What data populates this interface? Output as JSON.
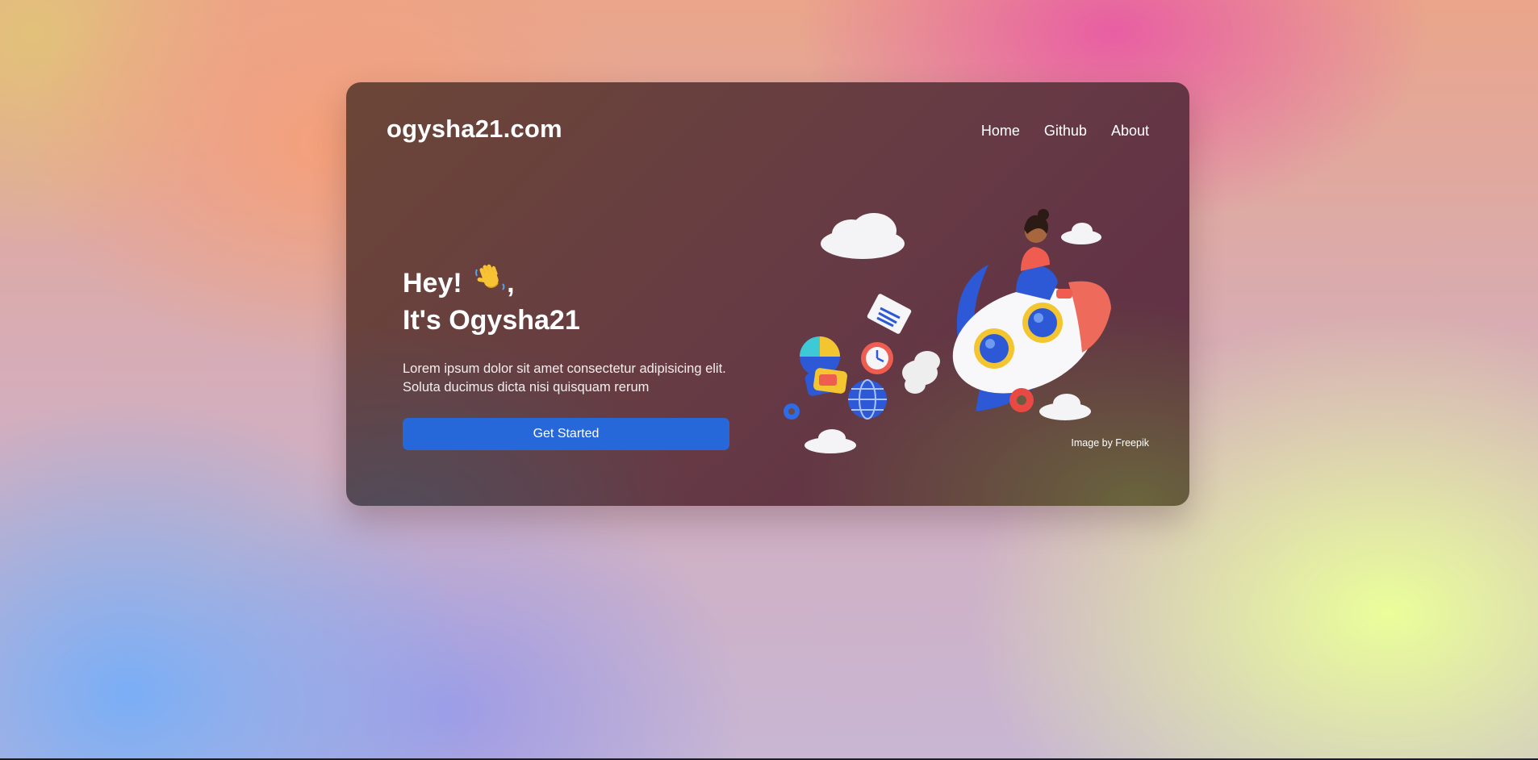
{
  "site": {
    "brand": "ogysha21.com"
  },
  "nav": {
    "items": [
      {
        "label": "Home"
      },
      {
        "label": "Github"
      },
      {
        "label": "About"
      }
    ]
  },
  "hero": {
    "greeting_line1": "Hey!",
    "greeting_line1_suffix": ",",
    "greeting_icon": "waving-hand-icon",
    "greeting_line2": "It's Ogysha21",
    "description_line1": "Lorem ipsum dolor sit amet consectetur adipisicing elit.",
    "description_line2": "Soluta ducimus dicta nisi quisquam rerum",
    "cta_label": "Get Started"
  },
  "illustration": {
    "subject": "rocket-with-woman-illustration",
    "credit": "Image by Freepik"
  },
  "colors": {
    "cta": "#2668da",
    "card_top": "#6b4637",
    "card_bottom_right": "#6a673c"
  }
}
